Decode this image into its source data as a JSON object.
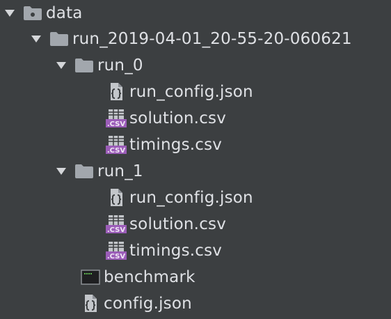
{
  "tree": {
    "data_folder": {
      "label": "data",
      "icon": "folder-module-icon",
      "expanded": true
    },
    "run_root": {
      "label": "run_2019-04-01_20-55-20-060621",
      "icon": "folder-icon",
      "expanded": true
    },
    "run_0": {
      "label": "run_0",
      "icon": "folder-icon",
      "expanded": true,
      "files": [
        {
          "label": "run_config.json",
          "icon": "json-file-icon"
        },
        {
          "label": "solution.csv",
          "icon": "csv-file-icon"
        },
        {
          "label": "timings.csv",
          "icon": "csv-file-icon"
        }
      ]
    },
    "run_1": {
      "label": "run_1",
      "icon": "folder-icon",
      "expanded": true,
      "files": [
        {
          "label": "run_config.json",
          "icon": "json-file-icon"
        },
        {
          "label": "solution.csv",
          "icon": "csv-file-icon"
        },
        {
          "label": "timings.csv",
          "icon": "csv-file-icon"
        }
      ]
    },
    "benchmark": {
      "label": "benchmark",
      "icon": "executable-file-icon"
    },
    "config": {
      "label": "config.json",
      "icon": "json-file-icon"
    },
    "colors": {
      "background": "#3c3f41",
      "text": "#dfe1e5",
      "folder": "#a2a7ad",
      "csv_badge": "#9b5db8"
    }
  }
}
